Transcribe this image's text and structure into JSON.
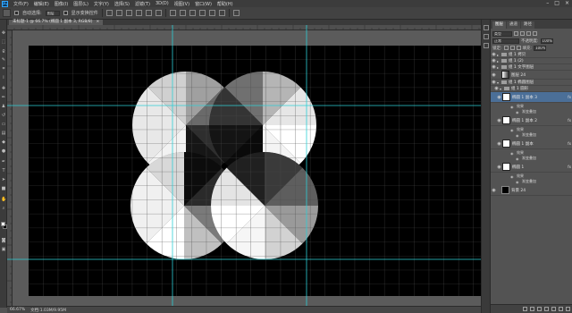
{
  "app": {
    "logo_text": "Ps",
    "menu": [
      "文件(F)",
      "编辑(E)",
      "图像(I)",
      "图层(L)",
      "文字(Y)",
      "选择(S)",
      "滤镜(T)",
      "3D(D)",
      "视图(V)",
      "窗口(W)",
      "帮助(H)"
    ],
    "window_controls": [
      "–",
      "□",
      "×"
    ]
  },
  "options_bar": {
    "auto_select_label": "自动选择:",
    "layer_select_value": "图层",
    "show_transform_label": "显示变换控件"
  },
  "document": {
    "tab_title": "未标题-1 @ 66.7% (椭圆 1 副本 3, RGB/8)",
    "close_glyph": "×"
  },
  "status_bar": {
    "zoom": "66.67%",
    "doc_info": "文档:1.03M/9.95M"
  },
  "layers_panel": {
    "tabs": [
      "图层",
      "通道",
      "路径"
    ],
    "kind_label": "类型",
    "blend_mode": "正常",
    "opacity_label": "不透明度:",
    "opacity_value": "100%",
    "lock_label": "锁定:",
    "fill_label": "填充:",
    "fill_value": "100%",
    "layers": [
      {
        "name": "组 1 拷贝",
        "kind": "group",
        "expanded": false,
        "selected": false
      },
      {
        "name": "组 1 (2)",
        "kind": "group",
        "expanded": false,
        "selected": false
      },
      {
        "name": "组 1 文字图层",
        "kind": "group",
        "expanded": false,
        "selected": false
      },
      {
        "name": "图层 24",
        "kind": "layer",
        "thumb": "gradient",
        "selected": false
      },
      {
        "name": "组 1 椭圆图层",
        "kind": "group",
        "expanded": true,
        "selected": false
      },
      {
        "name": "组 1 圆形",
        "kind": "group",
        "expanded": true,
        "selected": false
      },
      {
        "name": "椭圆 1 副本 3",
        "kind": "shape",
        "thumb": "white",
        "fx": "fx",
        "selected": true
      },
      {
        "name": "椭圆 1 副本 2",
        "kind": "shape",
        "thumb": "white",
        "fx": "fx",
        "selected": false
      },
      {
        "name": "椭圆 1 副本",
        "kind": "shape",
        "thumb": "white",
        "fx": "fx",
        "selected": false
      },
      {
        "name": "椭圆 1",
        "kind": "shape",
        "thumb": "white",
        "fx": "fx",
        "selected": false
      },
      {
        "name": "背景 24",
        "kind": "layer",
        "thumb": "black",
        "selected": false
      }
    ],
    "effect_label": "效果",
    "gradient_overlay_label": "渐变叠加"
  },
  "colors": {
    "guide": "#2ecfd6",
    "canvas": "#000000",
    "selection": "#4b6f98"
  }
}
